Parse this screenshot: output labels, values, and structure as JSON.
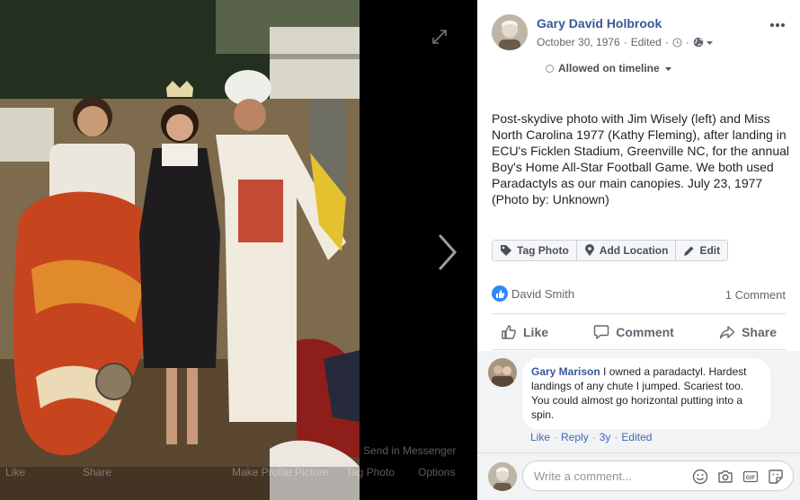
{
  "viewer": {
    "overlay": {
      "like": "Like",
      "share": "Share",
      "send": "Send in Messenger",
      "make_profile": "Make Profile Picture",
      "tag_photo": "Tag Photo",
      "options": "Options"
    }
  },
  "post": {
    "author": "Gary David Holbrook",
    "date": "October 30, 1976",
    "edited": "Edited",
    "timeline": "Allowed on timeline",
    "caption": "Post-skydive photo with Jim Wisely (left) and Miss North Carolina 1977 (Kathy Fleming), after landing in ECU's Ficklen Stadium, Greenville NC, for the annual Boy's Home All-Star Football Game. We both used Paradactyls as our main canopies. July 23, 1977 (Photo by: Unknown)"
  },
  "photo_actions": {
    "tag": "Tag Photo",
    "location": "Add Location",
    "edit": "Edit"
  },
  "reactions": {
    "liker": "David Smith",
    "comment_count": "1 Comment"
  },
  "buttons": {
    "like": "Like",
    "comment": "Comment",
    "share": "Share"
  },
  "comment": {
    "name": "Gary Marison",
    "text": "I owned a paradactyl. Hardest landings of any chute I jumped. Scariest too. You could almost go horizontal putting into a spin.",
    "like": "Like",
    "reply": "Reply",
    "age": "3y",
    "edited": "Edited"
  },
  "composer": {
    "placeholder": "Write a comment..."
  },
  "colors": {
    "link": "#385898",
    "accent": "#4267b2",
    "like_badge": "#2d88ff"
  }
}
